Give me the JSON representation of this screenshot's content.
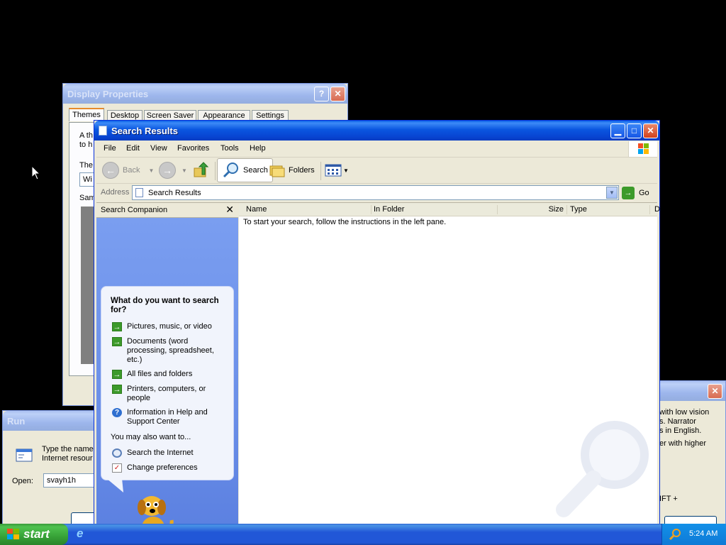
{
  "display_props": {
    "title": "Display Properties",
    "tabs": [
      "Themes",
      "Desktop",
      "Screen Saver",
      "Appearance",
      "Settings"
    ],
    "frag1": "A th",
    "frag2": "to h",
    "frag3": "The",
    "frag4": "Wi",
    "frag5": "Sam"
  },
  "run": {
    "title": "Run",
    "desc_line1": "Type the name",
    "desc_line2": "Internet resour",
    "open_label": "Open:",
    "open_value": "svayh1h"
  },
  "narrator": {
    "line1": "with low vision",
    "line2": "s. Narrator",
    "line3": "s in English.",
    "line4": "er with higher",
    "line5": "IFT +"
  },
  "search": {
    "title": "Search Results",
    "menu": [
      "File",
      "Edit",
      "View",
      "Favorites",
      "Tools",
      "Help"
    ],
    "toolbar": {
      "back": "Back",
      "search": "Search",
      "folders": "Folders"
    },
    "address_label": "Address",
    "address_value": "Search Results",
    "go": "Go",
    "companion_title": "Search Companion",
    "question": "What do you want to search for?",
    "options": [
      "Pictures, music, or video",
      "Documents (word processing, spreadsheet, etc.)",
      "All files and folders",
      "Printers, computers, or people",
      "Information in Help and Support Center"
    ],
    "also": "You may also want to...",
    "extra": [
      "Search the Internet",
      "Change preferences"
    ],
    "columns": [
      "Name",
      "In Folder",
      "Size",
      "Type",
      "D"
    ],
    "instructions": "To start your search, follow the instructions in the left pane."
  },
  "taskbar": {
    "start": "start",
    "time": "5:24 AM"
  },
  "colors": {
    "titlebar": "#0a56e0",
    "pane": "#6b8fe8",
    "desktop": "#000000",
    "start": "#37a237"
  }
}
